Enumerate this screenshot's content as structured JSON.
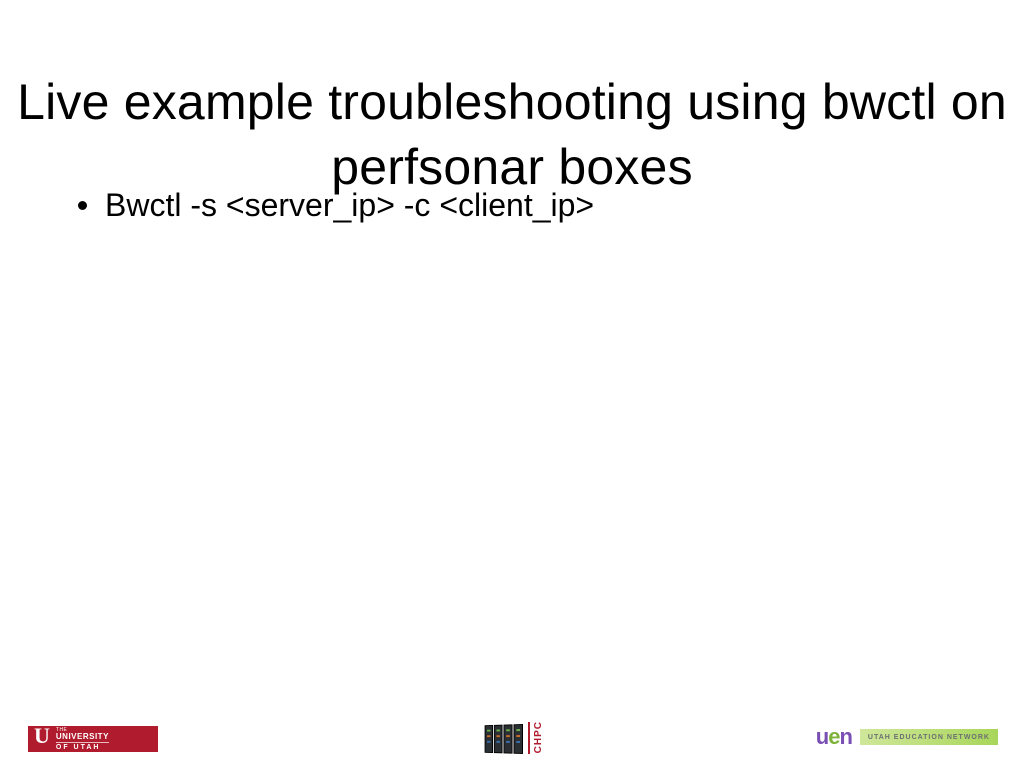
{
  "title": "Live example troubleshooting using bwctl on perfsonar boxes",
  "bullets": [
    {
      "text": "Bwctl -s <server_ip> -c <client_ip>"
    }
  ],
  "footer": {
    "left_logo": {
      "the": "THE",
      "line1": "UNIVERSITY",
      "line2": "OF UTAH",
      "mark": "U"
    },
    "center_logo": {
      "label": "CHPC"
    },
    "right_logo": {
      "mark_u": "u",
      "mark_e": "e",
      "mark_n": "n",
      "label": "UTAH EDUCATION NETWORK"
    }
  }
}
